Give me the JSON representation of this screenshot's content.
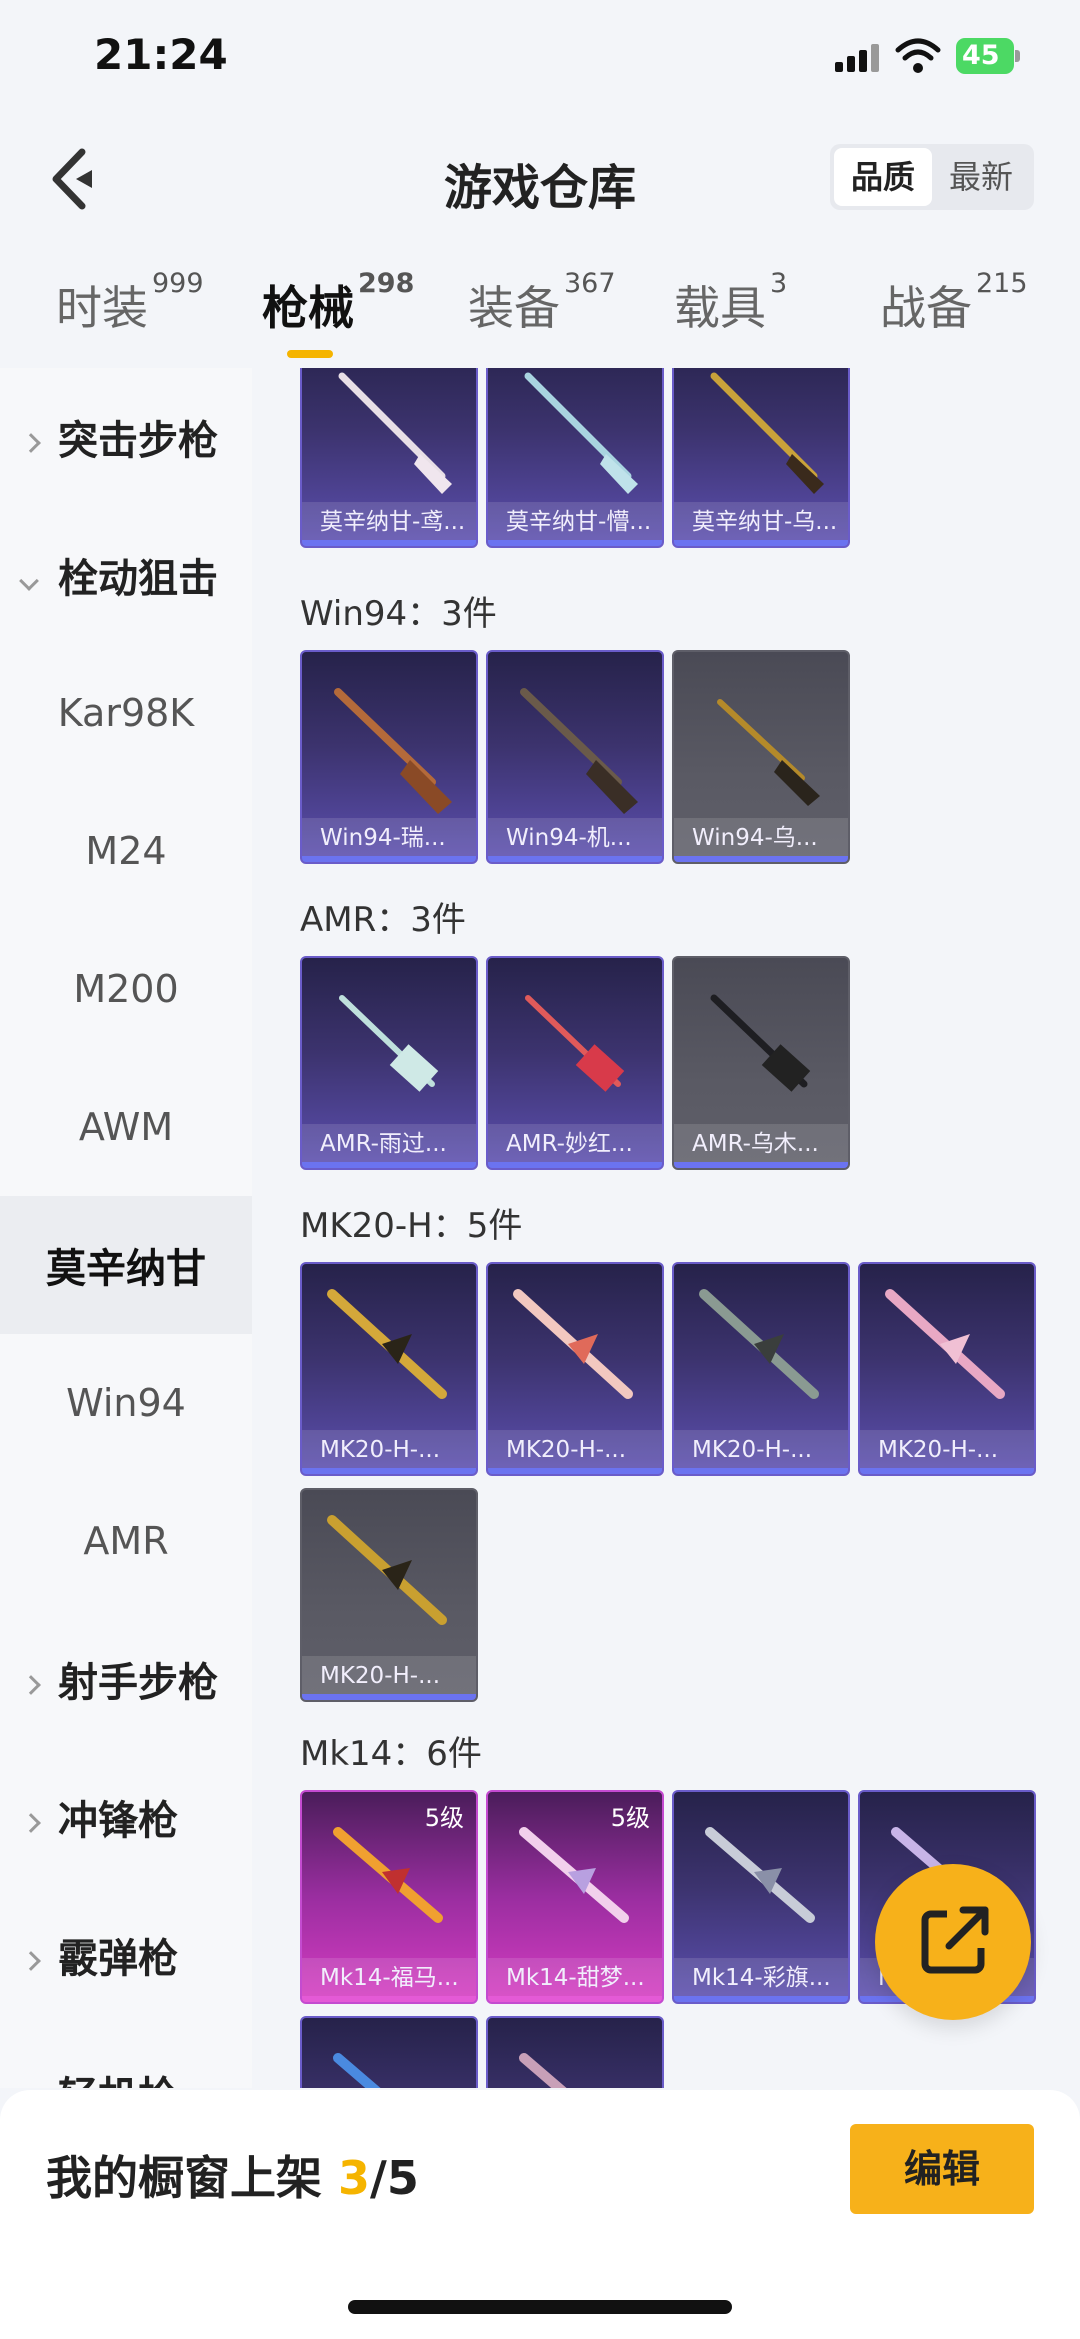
{
  "status": {
    "time": "21:24",
    "battery": "45"
  },
  "header": {
    "title": "游戏仓库",
    "sort_quality": "品质",
    "sort_newest": "最新"
  },
  "tabs": [
    {
      "label": "时装",
      "count": "999"
    },
    {
      "label": "枪械",
      "count": "298"
    },
    {
      "label": "装备",
      "count": "367"
    },
    {
      "label": "载具",
      "count": "3"
    },
    {
      "label": "战备",
      "count": "215"
    }
  ],
  "sidebar": {
    "items": [
      "突击步枪",
      "栓动狙击",
      "Kar98K",
      "M24",
      "M200",
      "AWM",
      "莫辛纳甘",
      "Win94",
      "AMR",
      "射手步枪",
      "冲锋枪",
      "霰弹枪",
      "轻机枪"
    ]
  },
  "groups": {
    "mosin": {
      "items": [
        {
          "name": "莫辛纳甘-鸢..."
        },
        {
          "name": "莫辛纳甘-懵..."
        },
        {
          "name": "莫辛纳甘-乌..."
        }
      ]
    },
    "win94": {
      "title": "Win94：3件",
      "items": [
        {
          "name": "Win94-瑞..."
        },
        {
          "name": "Win94-机..."
        },
        {
          "name": "Win94-乌..."
        }
      ]
    },
    "amr": {
      "title": "AMR：3件",
      "items": [
        {
          "name": "AMR-雨过..."
        },
        {
          "name": "AMR-妙红..."
        },
        {
          "name": "AMR-乌木..."
        }
      ]
    },
    "mk20": {
      "title": "MK20-H：5件",
      "items": [
        {
          "name": "MK20-H-..."
        },
        {
          "name": "MK20-H-..."
        },
        {
          "name": "MK20-H-..."
        },
        {
          "name": "MK20-H-..."
        },
        {
          "name": "MK20-H-..."
        }
      ]
    },
    "mk14": {
      "title": "Mk14：6件",
      "items": [
        {
          "name": "Mk14-福马...",
          "level": "5级"
        },
        {
          "name": "Mk14-甜梦...",
          "level": "5级"
        },
        {
          "name": "Mk14-彩旗..."
        },
        {
          "name": "M"
        }
      ]
    }
  },
  "bottom": {
    "label": "我的橱窗上架 ",
    "shelf_count": "3",
    "shelf_total": "/5",
    "edit": "编辑"
  },
  "icons": {
    "back": "back-arrow-icon",
    "share": "share-external-icon"
  },
  "colors": {
    "accent": "#f5b400",
    "card_purple": "#3c336e",
    "card_pink": "#c44bd0",
    "card_grey": "#5a5a64"
  }
}
